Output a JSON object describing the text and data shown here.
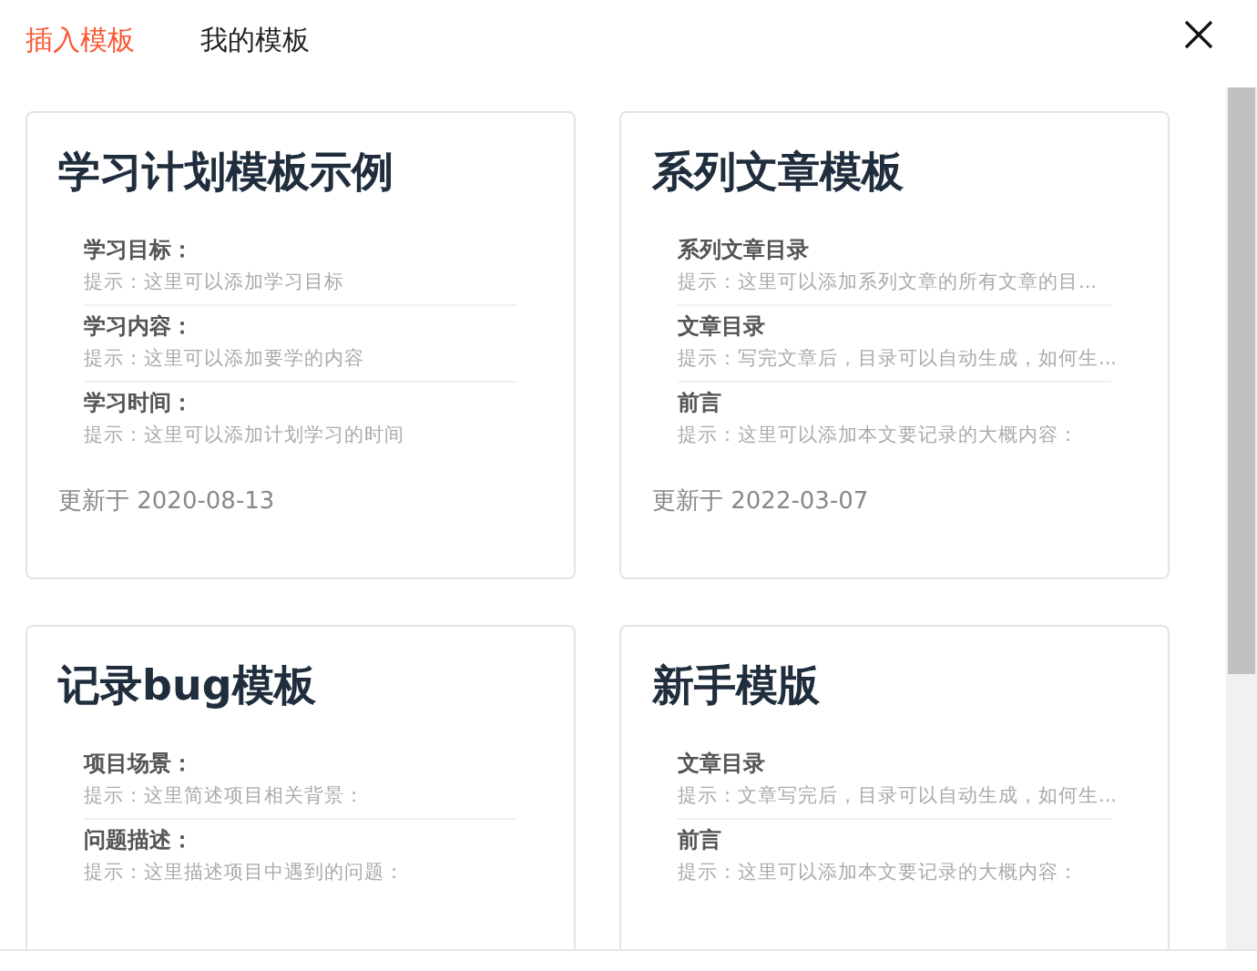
{
  "tabs": [
    {
      "label": "插入模板",
      "selected": true
    },
    {
      "label": "我的模板",
      "selected": false
    }
  ],
  "templates": [
    {
      "title": "学习计划模板示例",
      "sections": [
        {
          "heading": "学习目标：",
          "hint": "提示：这里可以添加学习目标"
        },
        {
          "heading": "学习内容：",
          "hint": "提示：这里可以添加要学的内容"
        },
        {
          "heading": "学习时间：",
          "hint": "提示：这里可以添加计划学习的时间"
        }
      ],
      "updated": "更新于 2020-08-13"
    },
    {
      "title": "系列文章模板",
      "sections": [
        {
          "heading": "系列文章目录",
          "hint": "提示：这里可以添加系列文章的所有文章的目..."
        },
        {
          "heading": "文章目录",
          "hint": "提示：写完文章后，目录可以自动生成，如何生..."
        },
        {
          "heading": "前言",
          "hint": "提示：这里可以添加本文要记录的大概内容："
        }
      ],
      "updated": "更新于 2022-03-07"
    },
    {
      "title": "记录bug模板",
      "sections": [
        {
          "heading": "项目场景：",
          "hint": "提示：这里简述项目相关背景："
        },
        {
          "heading": "问题描述：",
          "hint": "提示：这里描述项目中遇到的问题："
        }
      ]
    },
    {
      "title": "新手模版",
      "sections": [
        {
          "heading": "文章目录",
          "hint": "提示：文章写完后，目录可以自动生成，如何生..."
        },
        {
          "heading": "前言",
          "hint": "提示：这里可以添加本文要记录的大概内容："
        }
      ]
    }
  ]
}
